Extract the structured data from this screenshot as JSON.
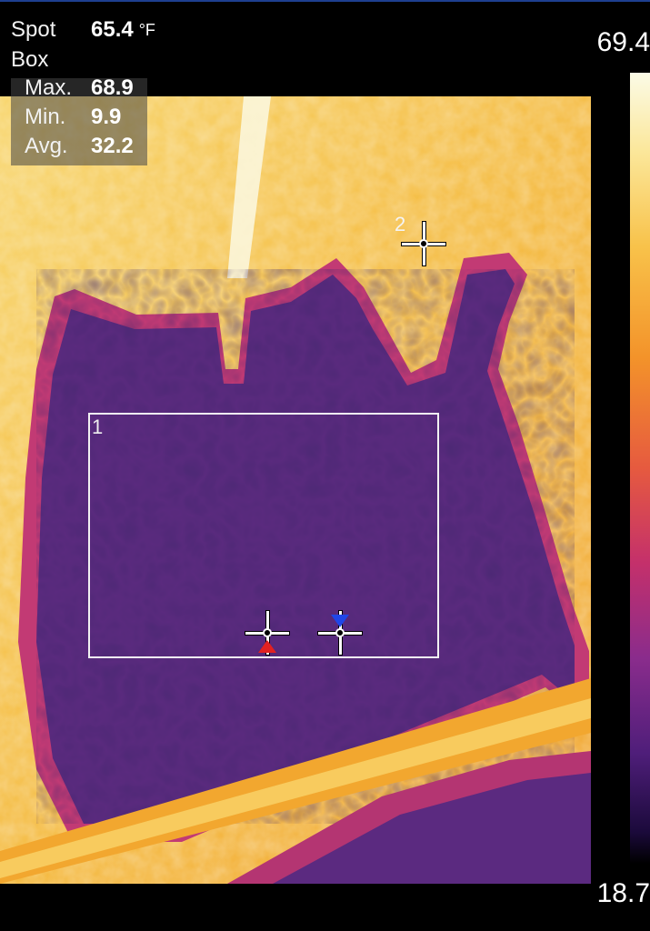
{
  "readout": {
    "spot_label": "Spot",
    "spot_value": "65.4",
    "unit": "°F",
    "box_label": "Box",
    "max_label": "Max.",
    "max_value": "68.9",
    "min_label": "Min.",
    "min_value": "9.9",
    "avg_label": "Avg.",
    "avg_value": "32.2"
  },
  "scale": {
    "max": "69.4",
    "min": "18.7",
    "palette": [
      "#fbfbe6",
      "#fbe79a",
      "#f8c24a",
      "#f3932a",
      "#e65a3f",
      "#c4306b",
      "#8a2c8c",
      "#4f1e7a",
      "#1b0a3b",
      "#000000"
    ]
  },
  "annotations": {
    "box_id": "1",
    "spot_id": "2",
    "spot_icon": "crosshair-icon",
    "max_marker_color": "#e12121",
    "min_marker_color": "#2046e8"
  },
  "colors": {
    "warm": "#f6c64a",
    "cold": "#5a2a7e",
    "edge": "#c23a74"
  }
}
